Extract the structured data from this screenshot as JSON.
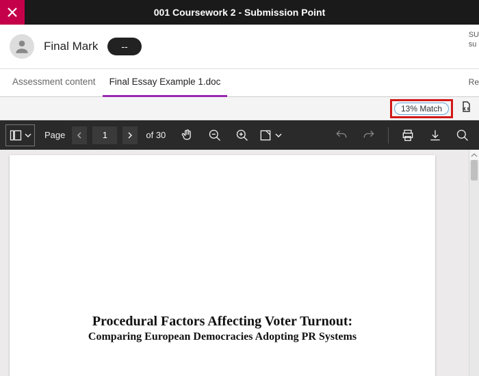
{
  "titlebar": {
    "title": "001 Coursework 2 - Submission Point"
  },
  "student": {
    "name_label": "Final Mark",
    "mark_value": "--"
  },
  "right_cut": {
    "line1": "SU",
    "line2": "su"
  },
  "tabs": {
    "assessment": "Assessment content",
    "file": "Final Essay Example 1.doc",
    "right_cut": "Re"
  },
  "match": {
    "badge": "13% Match"
  },
  "viewer": {
    "page_label": "Page",
    "page_current": "1",
    "page_total": "of 30"
  },
  "document": {
    "title": "Procedural Factors Affecting Voter Turnout:",
    "subtitle": "Comparing European Democracies Adopting PR Systems"
  }
}
